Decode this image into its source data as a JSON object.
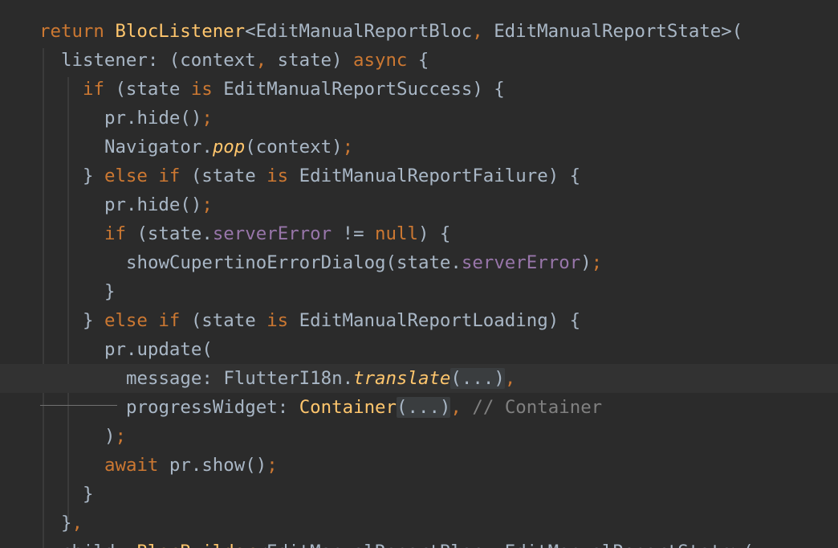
{
  "editor": {
    "language": "dart",
    "theme_colors": {
      "background": "#2b2b2b",
      "current_line": "#323232",
      "plain": "#a9b7c6",
      "keyword": "#cc7832",
      "class": "#ffc66d",
      "field": "#9876aa",
      "comment": "#808080"
    },
    "current_line_index": 12,
    "lines": [
      {
        "indent": 1,
        "tokens": [
          {
            "t": "return ",
            "k": "kw"
          },
          {
            "t": "BlocListener",
            "k": "class"
          },
          {
            "t": "<EditManualReportBloc",
            "k": "plain"
          },
          {
            "t": ", ",
            "k": "punct"
          },
          {
            "t": "EditManualReportState>(",
            "k": "plain"
          }
        ]
      },
      {
        "indent": 2,
        "tokens": [
          {
            "t": "listener: (context",
            "k": "plain"
          },
          {
            "t": ", ",
            "k": "punct"
          },
          {
            "t": "state) ",
            "k": "plain"
          },
          {
            "t": "async ",
            "k": "kw"
          },
          {
            "t": "{",
            "k": "plain"
          }
        ]
      },
      {
        "indent": 3,
        "tokens": [
          {
            "t": "if ",
            "k": "kw"
          },
          {
            "t": "(state ",
            "k": "plain"
          },
          {
            "t": "is ",
            "k": "kw"
          },
          {
            "t": "EditManualReportSuccess) {",
            "k": "plain"
          }
        ]
      },
      {
        "indent": 4,
        "tokens": [
          {
            "t": "pr.hide()",
            "k": "plain"
          },
          {
            "t": ";",
            "k": "punct"
          }
        ]
      },
      {
        "indent": 4,
        "tokens": [
          {
            "t": "Navigator.",
            "k": "plain"
          },
          {
            "t": "pop",
            "k": "func"
          },
          {
            "t": "(context)",
            "k": "plain"
          },
          {
            "t": ";",
            "k": "punct"
          }
        ]
      },
      {
        "indent": 3,
        "tokens": [
          {
            "t": "} ",
            "k": "plain"
          },
          {
            "t": "else if ",
            "k": "kw"
          },
          {
            "t": "(state ",
            "k": "plain"
          },
          {
            "t": "is ",
            "k": "kw"
          },
          {
            "t": "EditManualReportFailure) {",
            "k": "plain"
          }
        ]
      },
      {
        "indent": 4,
        "tokens": [
          {
            "t": "pr.hide()",
            "k": "plain"
          },
          {
            "t": ";",
            "k": "punct"
          }
        ]
      },
      {
        "indent": 4,
        "tokens": [
          {
            "t": "if ",
            "k": "kw"
          },
          {
            "t": "(state.",
            "k": "plain"
          },
          {
            "t": "serverError ",
            "k": "field"
          },
          {
            "t": "!= ",
            "k": "plain"
          },
          {
            "t": "null",
            "k": "kw"
          },
          {
            "t": ") {",
            "k": "plain"
          }
        ]
      },
      {
        "indent": 5,
        "tokens": [
          {
            "t": "showCupertinoErrorDialog(state.",
            "k": "plain"
          },
          {
            "t": "serverError",
            "k": "field"
          },
          {
            "t": ")",
            "k": "plain"
          },
          {
            "t": ";",
            "k": "punct"
          }
        ]
      },
      {
        "indent": 4,
        "tokens": [
          {
            "t": "}",
            "k": "plain"
          }
        ]
      },
      {
        "indent": 3,
        "tokens": [
          {
            "t": "} ",
            "k": "plain"
          },
          {
            "t": "else if ",
            "k": "kw"
          },
          {
            "t": "(state ",
            "k": "plain"
          },
          {
            "t": "is ",
            "k": "kw"
          },
          {
            "t": "EditManualReportLoading) {",
            "k": "plain"
          }
        ]
      },
      {
        "indent": 4,
        "tokens": [
          {
            "t": "pr.update(",
            "k": "plain"
          }
        ]
      },
      {
        "indent": 5,
        "tokens": [
          {
            "t": "message: FlutterI18n.",
            "k": "plain"
          },
          {
            "t": "translate",
            "k": "func"
          },
          {
            "t": "(...)",
            "k": "fold"
          },
          {
            "t": ",",
            "k": "punct"
          }
        ]
      },
      {
        "indent": 5,
        "tokens": [
          {
            "t": "progressWidget: ",
            "k": "plain"
          },
          {
            "t": "Container",
            "k": "class"
          },
          {
            "t": "(...)",
            "k": "fold"
          },
          {
            "t": ", ",
            "k": "punct"
          },
          {
            "t": "// Container",
            "k": "comment"
          }
        ]
      },
      {
        "indent": 4,
        "tokens": [
          {
            "t": ")",
            "k": "plain"
          },
          {
            "t": ";",
            "k": "punct"
          }
        ]
      },
      {
        "indent": 4,
        "tokens": [
          {
            "t": "await ",
            "k": "kw"
          },
          {
            "t": "pr.show()",
            "k": "plain"
          },
          {
            "t": ";",
            "k": "punct"
          }
        ]
      },
      {
        "indent": 3,
        "tokens": [
          {
            "t": "}",
            "k": "plain"
          }
        ]
      },
      {
        "indent": 2,
        "tokens": [
          {
            "t": "}",
            "k": "plain"
          },
          {
            "t": ",",
            "k": "punct"
          }
        ]
      },
      {
        "indent": 2,
        "tokens": [
          {
            "t": "child: ",
            "k": "plain"
          },
          {
            "t": "BlocBuilder",
            "k": "class"
          },
          {
            "t": "<EditManualReportBloc",
            "k": "plain"
          },
          {
            "t": ", ",
            "k": "punct"
          },
          {
            "t": "EditManualReportState>(",
            "k": "plain"
          }
        ]
      }
    ]
  }
}
